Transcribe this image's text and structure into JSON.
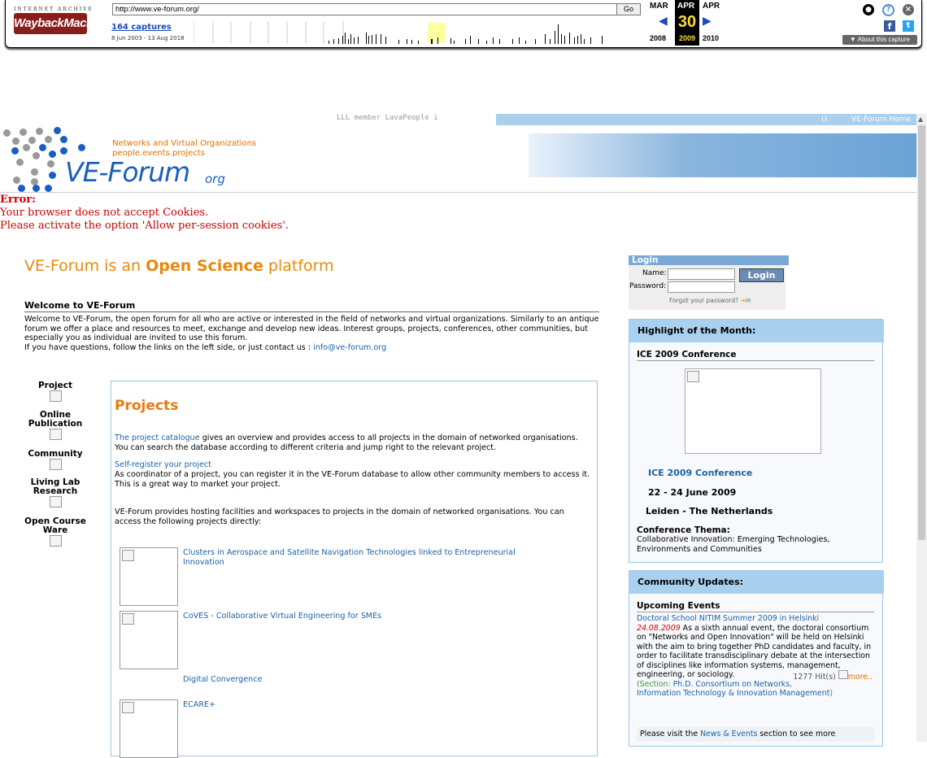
{
  "wayback": {
    "logo_top": "INTERNET ARCHIVE",
    "logo": "WaybackMachine",
    "url": "http://www.ve-forum.org/",
    "go_label": "Go",
    "captures": "164 captures",
    "range": "8 Jun 2003 - 13 Aug 2018",
    "prev_month": "MAR",
    "cur_month": "APR",
    "next_month": "APR",
    "day": "30",
    "prev_year": "2008",
    "cur_year": "2009",
    "next_year": "2010",
    "about": "▼ About this capture",
    "accent": "#ffdb3a"
  },
  "header": {
    "lll": "LLL member LavaPeople i",
    "banner_link_1": "()",
    "banner_link_2": "VE-Forum Home",
    "logo_sub1": "Networks and Virtual Organizations",
    "logo_sub2": "people.events.projects",
    "logo_main": "VE-Forum",
    "logo_org": "org"
  },
  "error": {
    "title": "Error:",
    "line1": "Your browser does not accept Cookies.",
    "line2": "Please activate the option 'Allow per-session cookies'."
  },
  "main": {
    "headline_pre": "VE-Forum is an ",
    "headline_bold": "Open Science",
    "headline_post": " platform",
    "welcome_title": "Welcome to VE-Forum",
    "welcome_text": "Welcome to VE-Forum, the open forum for all who are active or interested in the field of networks and virtual organizations. Similarly to an antique forum we offer a place and resources to meet, exchange and develop new ideas. Interest groups, projects, conferences, other communities, but especially you as individual are invited to use this forum.",
    "welcome_contact": "If you have questions, follow the links on the left side, or just contact us : ",
    "contact_email": "info@ve-forum.org"
  },
  "nav": [
    {
      "label": "Project"
    },
    {
      "label": "Online Publication"
    },
    {
      "label": "Community"
    },
    {
      "label": "Living Lab Research"
    },
    {
      "label": "Open Course Ware"
    }
  ],
  "projects": {
    "title": "Projects",
    "catalogue_link": "The project catalogue",
    "catalogue_text": " gives an overview and provides access to all projects in the domain of networked organisations. You can search the database according to different criteria and jump right to the relevant project.",
    "register_link": "Self-register your project",
    "register_text": "As coordinator of a project, you can register it in the VE-Forum database to allow other community members to access it. This is a great way to market your project.",
    "hosting_text": "VE-Forum provides hosting facilities and workspaces to projects in the domain of networked organisations. You can access the following projects directly:",
    "items": [
      {
        "label": "Clusters in Aerospace and Satellite Navigation Technologies linked to Entrepreneurial Innovation"
      },
      {
        "label": "CoVES - Collaborative Virtual Engineering for SMEs"
      },
      {
        "label": "Digital Convergence"
      },
      {
        "label": "ECARE+"
      }
    ]
  },
  "login": {
    "title": "Login",
    "name_label": "Name:",
    "password_label": "Password:",
    "button": "Login",
    "forgot": "Forgot your password?"
  },
  "highlight": {
    "title": "Highlight of the Month:",
    "subtitle": "ICE 2009 Conference",
    "conf_link": "ICE 2009 Conference",
    "dates": "22 - 24 June 2009",
    "place": "Leiden - The Netherlands",
    "thema_label": "Conference Thema:",
    "thema": "Collaborative Innovation: Emerging Technologies, Environments and Communities"
  },
  "community": {
    "title": "Community Updates:",
    "upcoming": "Upcoming Events",
    "event_link": "Doctoral School NITIM Summer 2009 in Helsinki",
    "event_date": "24.08.2009",
    "event_text": " As a sixth annual event, the doctoral consortium on \"Networks and Open Innovation\" will be held on Helsinki with the aim to bring together PhD candidates and faculty, in order to facilitate transdisciplinary debate at the intersection of disciplines like information systems, management, engineering, or sociology.",
    "hits": "1277 Hit(s)",
    "more": "more..",
    "section_pre": "(Section: ",
    "section_link": "Ph.D. Consortium on Networks, Information Technology & Innovation Management",
    "section_post": ")",
    "visit_pre": "Please visit the ",
    "visit_link": "News & Events",
    "visit_post": " section to see more"
  }
}
